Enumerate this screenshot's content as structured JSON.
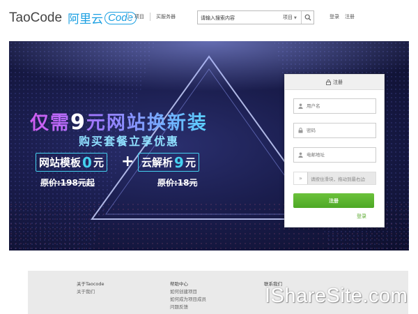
{
  "header": {
    "logo_text": "TaoCode",
    "logo_cn": "阿里云",
    "logo_code": "Code",
    "nav": [
      "项目",
      "买服务器"
    ],
    "search": {
      "value": "请输入搜索内容",
      "scope": "项目"
    },
    "auth": {
      "login": "登录",
      "register": "注册"
    }
  },
  "banner": {
    "headline_pre": "仅需",
    "headline_num": "9",
    "headline_post": "元网站换新装",
    "subline": "购买套餐立享优惠",
    "offer1": {
      "label": "网站模板",
      "price": "0",
      "unit": "元",
      "original": "原价:198元起"
    },
    "plus": "+",
    "offer2": {
      "label": "云解析",
      "price": "9",
      "unit": "元",
      "original": "原价:18元"
    },
    "colors": {
      "accent": "#45d1f0",
      "bg": "#1a1d4d"
    }
  },
  "register": {
    "title": "注册",
    "username_placeholder": "用户名",
    "password_placeholder": "密码",
    "email_placeholder": "电邮地址",
    "slider_hint": "请按住滑块，拖动到最右边",
    "submit": "注册",
    "login_link": "登录",
    "colors": {
      "button": "#5cb631"
    }
  },
  "footer": {
    "col1": {
      "title": "关于Taocode",
      "links": [
        "关于我们"
      ]
    },
    "col2": {
      "title": "帮助中心",
      "links": [
        "如何创建项目",
        "如何成为项目成员",
        "问题反馈"
      ]
    },
    "col3": {
      "title": "联系我们",
      "links": []
    }
  },
  "watermark": "IShareSite.com"
}
